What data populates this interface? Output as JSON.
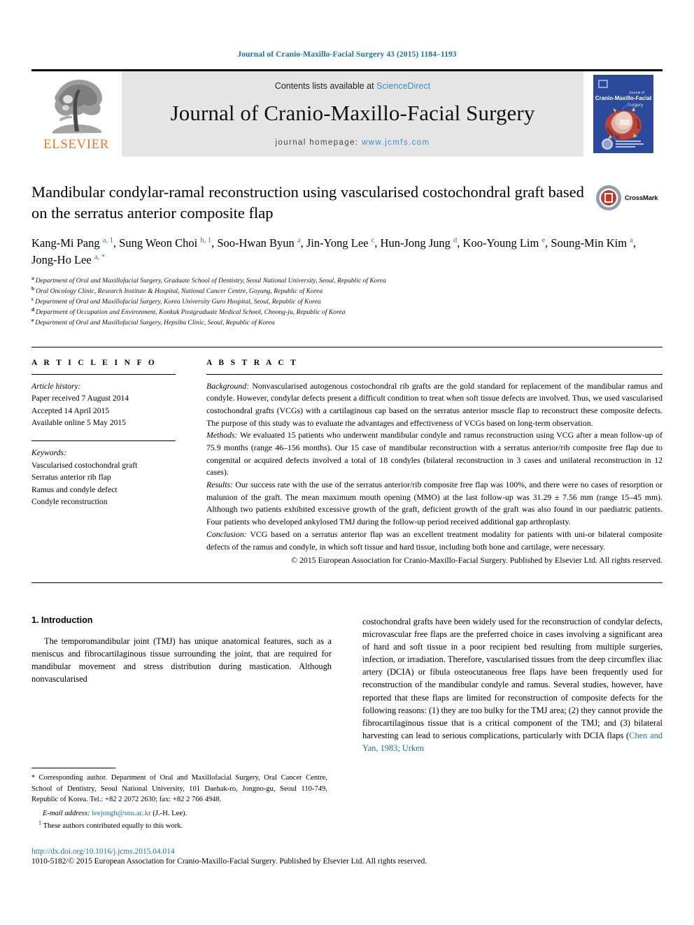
{
  "running_head": "Journal of Cranio-Maxillo-Facial Surgery 43 (2015) 1184–1193",
  "masthead": {
    "publisher_name": "ELSEVIER",
    "publisher_logo_icon": "elsevier-tree-icon",
    "contents_prefix": "Contents lists available at ",
    "contents_link": "ScienceDirect",
    "journal_name": "Journal of Cranio-Maxillo-Facial Surgery",
    "homepage_label": "journal homepage:",
    "homepage_url": "www.jcmfs.com",
    "cover_icon": "journal-cover-thumbnail"
  },
  "article": {
    "title": "Mandibular condylar-ramal reconstruction using vascularised costochondral graft based on the serratus anterior composite flap",
    "crossmark_label": "CrossMark",
    "authors": [
      {
        "name": "Kang-Mi Pang",
        "marks": "a, 1",
        "sep": ", "
      },
      {
        "name": "Sung Weon Choi",
        "marks": "b, 1",
        "sep": ", "
      },
      {
        "name": "Soo-Hwan Byun",
        "marks": "a",
        "sep": ", "
      },
      {
        "name": "Jin-Yong Lee",
        "marks": "c",
        "sep": ", "
      },
      {
        "name": "Hun-Jong Jung",
        "marks": "d",
        "sep": ", "
      },
      {
        "name": "Koo-Young Lim",
        "marks": "e",
        "sep": ", "
      },
      {
        "name": "Soung-Min Kim",
        "marks": "a",
        "sep": ", "
      },
      {
        "name": "Jong-Ho Lee",
        "marks": "a, *",
        "sep": ""
      }
    ],
    "affiliations": [
      {
        "mark": "a",
        "text": "Department of Oral and Maxillofacial Surgery, Graduate School of Dentistry, Seoul National University, Seoul, Republic of Korea"
      },
      {
        "mark": "b",
        "text": "Oral Oncology Clinic, Research Institute & Hospital, National Cancer Centre, Goyang, Republic of Korea"
      },
      {
        "mark": "c",
        "text": "Department of Oral and Maxillofacial Surgery, Korea University Guro Hospital, Seoul, Republic of Korea"
      },
      {
        "mark": "d",
        "text": "Department of Occupation and Environment, Konkuk Postgraduate Medical School, Choong-ju, Republic of Korea"
      },
      {
        "mark": "e",
        "text": "Department of Oral and Maxillofacial Surgery, Hepsiba Clinic, Seoul, Republic of Korea"
      }
    ]
  },
  "article_info": {
    "heading": "A R T I C L E  I N F O",
    "history_label": "Article history:",
    "history": [
      "Paper received 7 August 2014",
      "Accepted 14 April 2015",
      "Available online 5 May 2015"
    ],
    "keywords_label": "Keywords:",
    "keywords": [
      "Vascularised costochondral graft",
      "Serratus anterior rib flap",
      "Ramus and condyle defect",
      "Condyle reconstruction"
    ]
  },
  "abstract": {
    "heading": "A B S T R A C T",
    "sections": [
      {
        "label": "Background:",
        "text": " Nonvascularised autogenous costochondral rib grafts are the gold standard for replacement of the mandibular ramus and condyle. However, condylar defects present a difficult condition to treat when soft tissue defects are involved. Thus, we used vascularised costochondral grafts (VCGs) with a cartilaginous cap based on the serratus anterior muscle flap to reconstruct these composite defects. The purpose of this study was to evaluate the advantages and effectiveness of VCGs based on long-term observation."
      },
      {
        "label": "Methods:",
        "text": " We evaluated 15 patients who underwent mandibular condyle and ramus reconstruction using VCG after a mean follow-up of 75.9 months (range 46–156 months). Our 15 case of mandibular reconstruction with a serratus anterior/rib composite free flap due to congenital or acquired defects involved a total of 18 condyles (bilateral reconstruction in 3 cases and unilateral reconstruction in 12 cases)."
      },
      {
        "label": "Results:",
        "text": " Our success rate with the use of the serratus anterior/rib composite free flap was 100%, and there were no cases of resorption or malunion of the graft. The mean maximum mouth opening (MMO) at the last follow-up was 31.29 ± 7.56 mm (range 15–45 mm). Although two patients exhibited excessive growth of the graft, deficient growth of the graft was also found in our paediatric patients. Four patients who developed ankylosed TMJ during the follow-up period received additional gap arthroplasty."
      },
      {
        "label": "Conclusion:",
        "text": " VCG based on a serratus anterior flap was an excellent treatment modality for patients with uni-or bilateral composite defects of the ramus and condyle, in which soft tissue and hard tissue, including both bone and cartilage, were necessary."
      }
    ],
    "copyright": "© 2015 European Association for Cranio-Maxillo-Facial Surgery. Published by Elsevier Ltd. All rights reserved."
  },
  "introduction": {
    "heading": "1.  Introduction",
    "left_paragraph": "The temporomandibular joint (TMJ) has unique anatomical features, such as a meniscus and fibrocartilaginous tissue surrounding the joint, that are required for mandibular movement and stress distribution during mastication. Although nonvascularised",
    "right_paragraph_pre": "costochondral grafts have been widely used for the reconstruction of condylar defects, microvascular free flaps are the preferred choice in cases involving a significant area of hard and soft tissue in a poor recipient bed resulting from multiple surgeries, infection, or irradiation. Therefore, vascularised tissues from the deep circumflex iliac artery (DCIA) or fibula osteocutaneous free flaps have been frequently used for reconstruction of the mandibular condyle and ramus. Several studies, however, have reported that these flaps are limited for reconstruction of composite defects for the following reasons: (1) they are too bulky for the TMJ area; (2) they cannot provide the fibrocartilaginous tissue that is a critical component of the TMJ; and (3) bilateral harvesting can lead to serious complications, particularly with DCIA flaps (",
    "right_paragraph_citation": "Chen and Yan, 1983; Urken",
    "right_paragraph_post": ""
  },
  "footnotes": {
    "corresponding": "Corresponding author. Department of Oral and Maxillofacial Surgery, Oral Cancer Centre, School of Dentistry, Seoul National University, 101 Daehak-ro, Jongno-gu, Seoul 110-749, Republic of Korea. Tel.: +82 2 2072 2630; fax: +82 2 766 4948.",
    "corresponding_mark": "*",
    "email_label": "E-mail address:",
    "email_address": "leejongh@snu.ac.kr",
    "email_suffix": " (J.-H. Lee).",
    "equal_mark": "1",
    "equal_contribution": "These authors contributed equally to this work."
  },
  "bottom": {
    "doi": "http://dx.doi.org/10.1016/j.jcms.2015.04.014",
    "issn_line": "1010-5182/© 2015 European Association for Cranio-Maxillo-Facial Surgery. Published by Elsevier Ltd. All rights reserved."
  },
  "colors": {
    "link_blue": "#1a6fa8",
    "elsevier_orange": "#E87722",
    "masthead_grey": "#e6e6e6",
    "cover_blue": "#2b4a9b"
  }
}
